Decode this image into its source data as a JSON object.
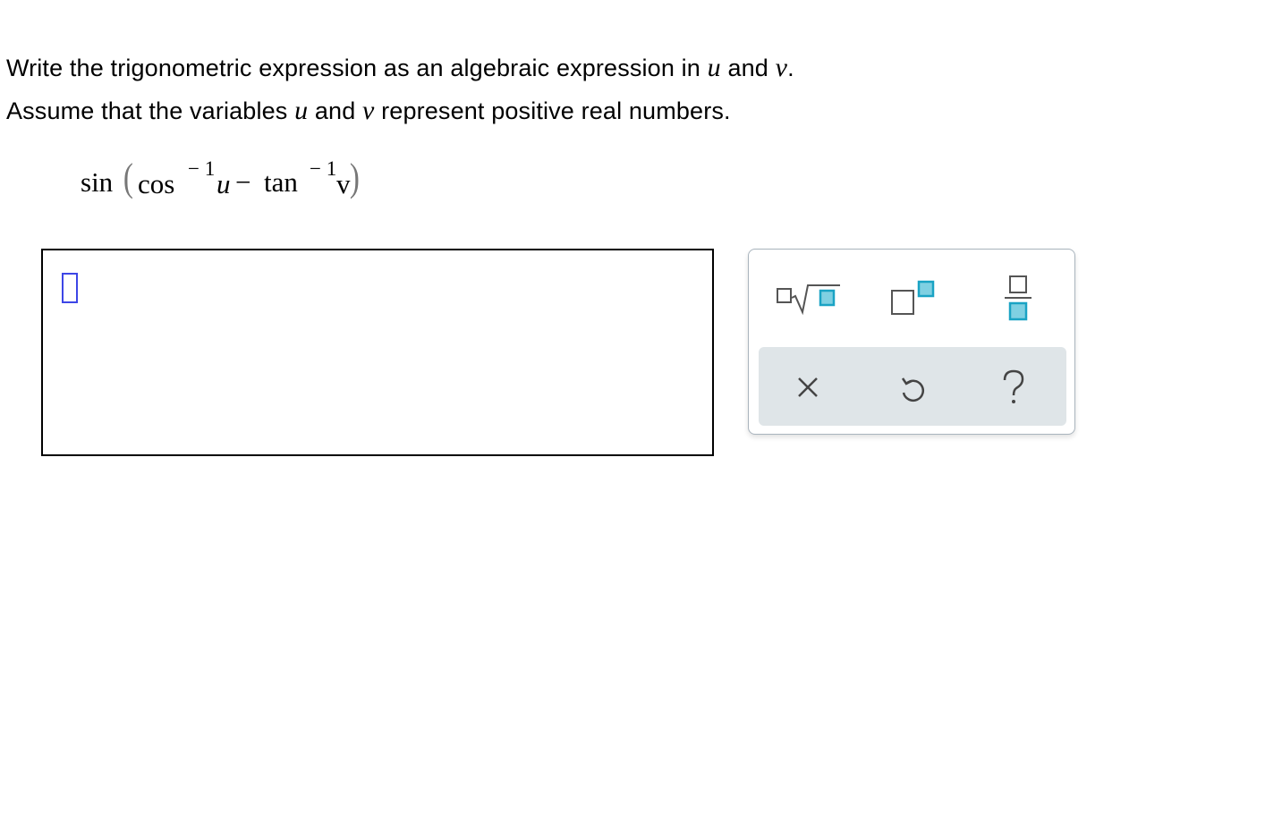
{
  "question": {
    "line1": {
      "before": "Write the trigonometric expression as an algebraic expression in ",
      "var1": "u",
      "middle": " and ",
      "var2": "v",
      "after": "."
    },
    "line2": {
      "before": "Assume that the variables ",
      "var1": "u",
      "middle": " and ",
      "var2": "v",
      "after": " represent positive real numbers."
    },
    "expression": {
      "sin": "sin",
      "open_paren": "(",
      "cos": "cos",
      "exp1": "− 1",
      "u": "u",
      "minus": "−",
      "tan": "tan",
      "exp2": "− 1",
      "v": "v",
      "close_paren": ")"
    }
  },
  "palette": {
    "tools": [
      {
        "icon": "nth-root-icon"
      },
      {
        "icon": "superscript-icon"
      },
      {
        "icon": "fraction-icon"
      }
    ],
    "actions": [
      {
        "icon": "clear-icon"
      },
      {
        "icon": "undo-icon"
      },
      {
        "icon": "help-icon"
      }
    ]
  },
  "colors": {
    "accent": "#1aa3c4",
    "accent_fill": "#7fd0e2",
    "cursor": "#3d46e6",
    "action_bar": "#dfe5e8"
  }
}
